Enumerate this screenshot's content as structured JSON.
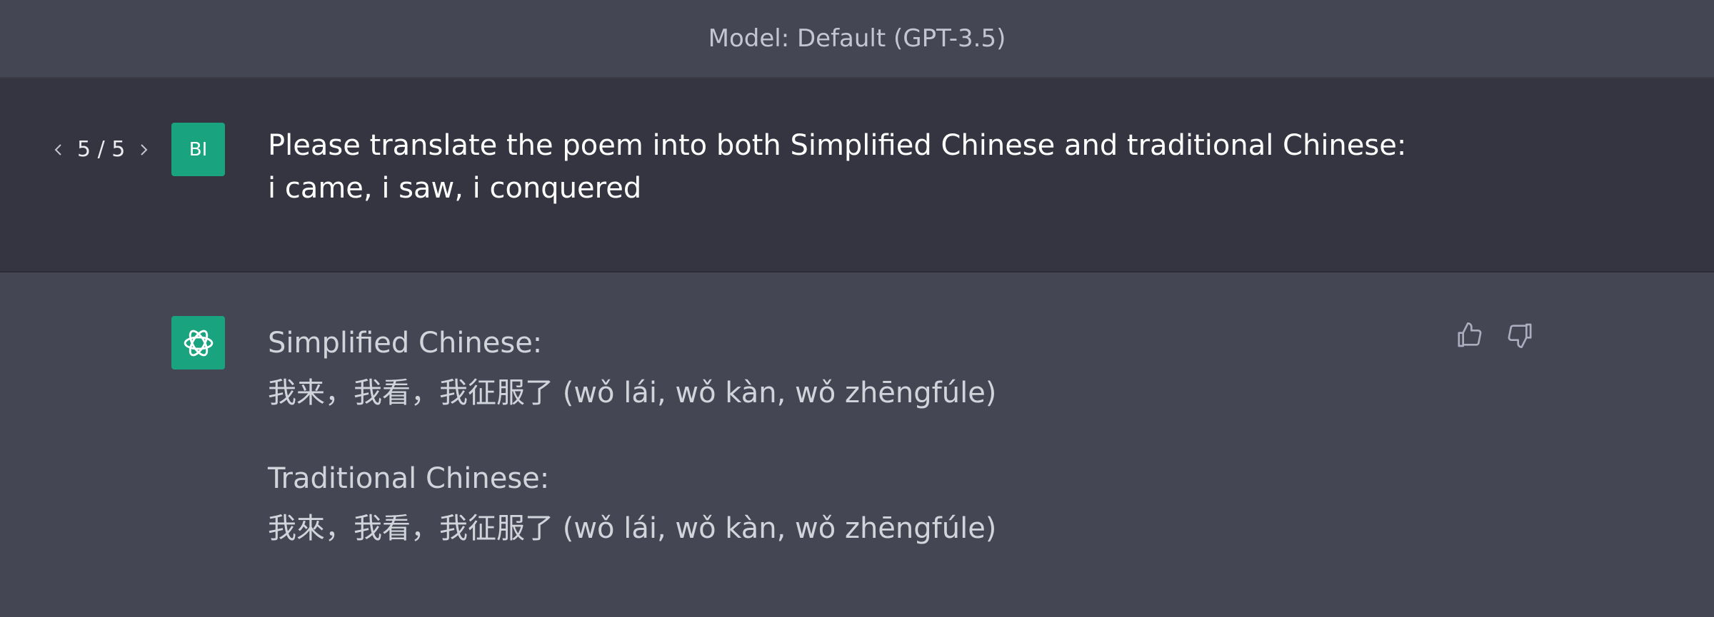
{
  "header": {
    "model_label": "Model: Default (GPT-3.5)"
  },
  "user_message": {
    "pager": "5 / 5",
    "avatar_initials": "BI",
    "lines": [
      "Please translate the poem into both Simplified Chinese and traditional Chinese:",
      "i came, i saw, i conquered"
    ]
  },
  "assistant_message": {
    "blocks": [
      {
        "heading": "Simplified Chinese:",
        "text": "我来，我看，我征服了 (wǒ lái, wǒ kàn, wǒ zhēngfúle)"
      },
      {
        "heading": "Traditional Chinese:",
        "text": "我來，我看，我征服了 (wǒ lái, wǒ kàn, wǒ zhēngfúle)"
      }
    ]
  },
  "icons": {
    "prev": "chevron-left-icon",
    "next": "chevron-right-icon",
    "assistant_logo": "openai-logo-icon",
    "like": "thumbs-up-icon",
    "dislike": "thumbs-down-icon"
  },
  "colors": {
    "accent": "#19a37f",
    "user_bg": "#343541",
    "assistant_bg": "#444654"
  }
}
